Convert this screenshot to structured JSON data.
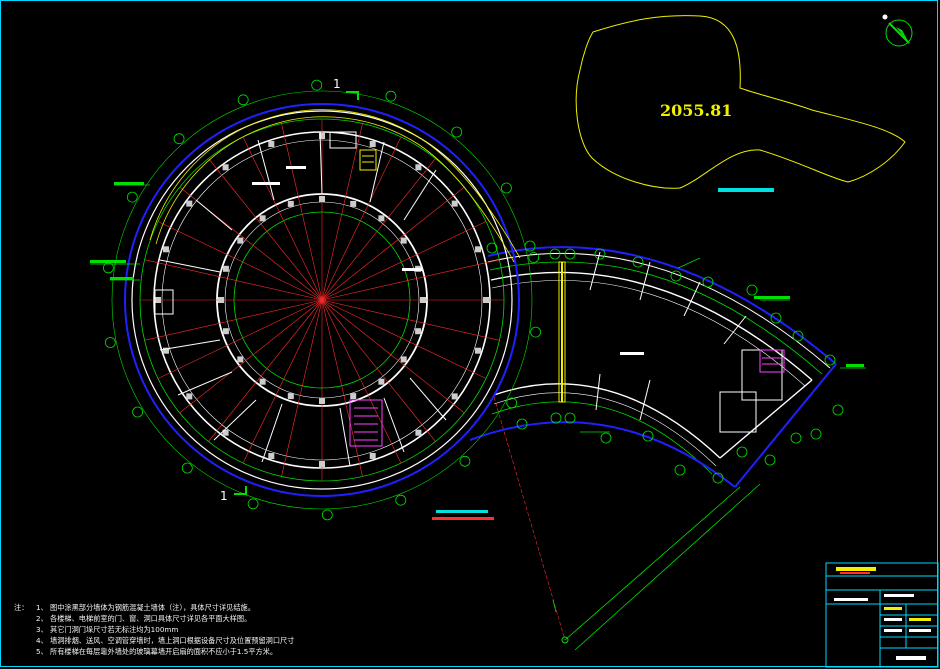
{
  "site_plan": {
    "area_value": "2055.81"
  },
  "section_marks": {
    "top": "1",
    "bottom": "1"
  },
  "notes": {
    "lead": "注：",
    "items": [
      "1、 图中涂黑部分墙体为钢筋混凝土墙体（注），具体尺寸详见结施。",
      "2、 各楼梯、电梯前室的门、窗、洞口具体尺寸详见各平面大样图。",
      "3、 其它门洞门垛尺寸若无标注均为100mm",
      "4、 墙洞排烟、送风、空调管穿墙时，墙上洞口根据设备尺寸及位置预留洞口尺寸",
      "5、 所有楼梯在每层靠外墙处的玻璃幕墙开启扇的面积不应小于1.5平方米。"
    ]
  },
  "colors": {
    "background": "#000000",
    "frame": "#00d8ff",
    "axis_grid": "#ff2a2a",
    "walls": "#ffffff",
    "dimension": "#00e000",
    "outer_ring": "#2020ff",
    "site_outline": "#f0f000",
    "stairs": "#ff40ff"
  },
  "icons": {
    "north_arrow": "north-arrow-icon",
    "axis_bubble": "axis-bubble-icon"
  }
}
